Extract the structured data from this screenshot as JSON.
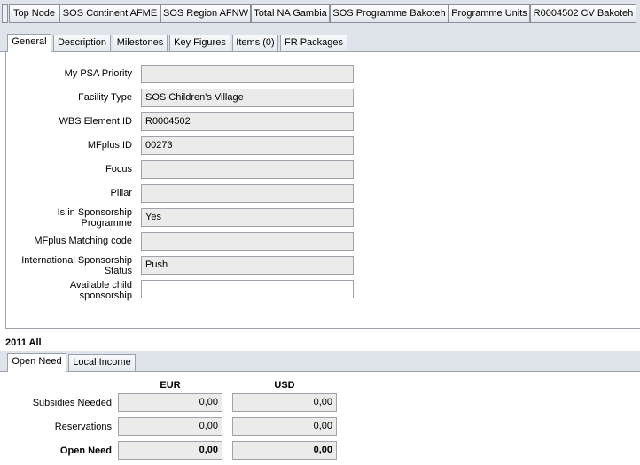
{
  "breadcrumb": {
    "items": [
      {
        "label": "Top Node"
      },
      {
        "label": "SOS Continent AFME"
      },
      {
        "label": "SOS Region AFNW"
      },
      {
        "label": "Total NA Gambia"
      },
      {
        "label": "SOS Programme Bakoteh"
      },
      {
        "label": "Programme Units"
      },
      {
        "label": "R0004502 CV Bakoteh"
      }
    ]
  },
  "tabs": {
    "items": [
      {
        "label": "General",
        "active": true
      },
      {
        "label": "Description"
      },
      {
        "label": "Milestones"
      },
      {
        "label": "Key Figures"
      },
      {
        "label": "Items (0)"
      },
      {
        "label": "FR Packages"
      }
    ]
  },
  "general": {
    "fields": [
      {
        "label": "My PSA Priority",
        "value": ""
      },
      {
        "label": "Facility Type",
        "value": "SOS Children's Village"
      },
      {
        "label": "WBS Element ID",
        "value": "R0004502"
      },
      {
        "label": "MFplus ID",
        "value": "00273"
      },
      {
        "label": "Focus",
        "value": ""
      },
      {
        "label": "Pillar",
        "value": ""
      },
      {
        "label": "Is in Sponsorship Programme",
        "value": "Yes"
      },
      {
        "label": "MFplus Matching code",
        "value": ""
      },
      {
        "label": "International Sponsorship Status",
        "value": "Push"
      },
      {
        "label": "Available child sponsorship",
        "value": ""
      }
    ]
  },
  "section": {
    "title": "2011  All"
  },
  "subtabs": {
    "items": [
      {
        "label": "Open Need",
        "active": true
      },
      {
        "label": "Local Income"
      }
    ]
  },
  "open_need": {
    "columns": [
      "EUR",
      "USD"
    ],
    "rows": [
      {
        "label": "Subsidies Needed",
        "eur": "0,00",
        "usd": "0,00"
      },
      {
        "label": "Reservations",
        "eur": "0,00",
        "usd": "0,00"
      },
      {
        "label": "Open Need",
        "eur": "0,00",
        "usd": "0,00",
        "bold": true
      }
    ]
  },
  "colors": {
    "chrome": "#dfe3ea",
    "field_readonly": "#ebebeb",
    "border": "#9aa1ad"
  }
}
